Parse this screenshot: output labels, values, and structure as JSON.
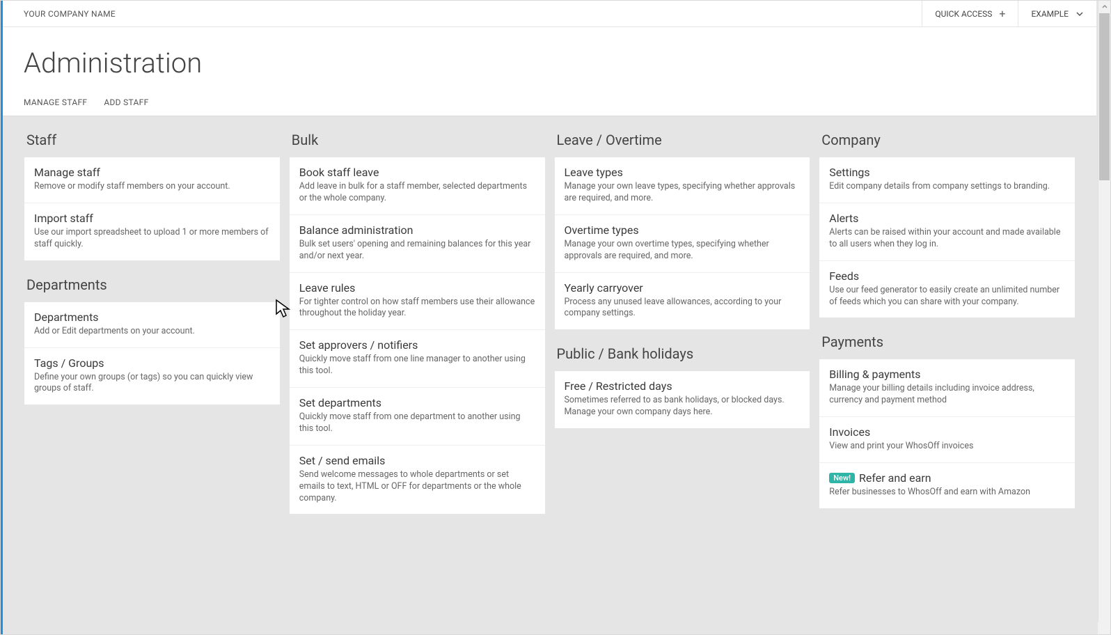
{
  "header": {
    "company": "YOUR COMPANY NAME",
    "quick_access": "QUICK ACCESS",
    "user_label": "EXAMPLE"
  },
  "page_title": "Administration",
  "tabs": {
    "manage_staff": "MANAGE STAFF",
    "add_staff": "ADD STAFF"
  },
  "sections": {
    "staff": {
      "title": "Staff"
    },
    "departments": {
      "title": "Departments"
    },
    "bulk": {
      "title": "Bulk"
    },
    "leave_overtime": {
      "title": "Leave / Overtime"
    },
    "public_bank": {
      "title": "Public / Bank holidays"
    },
    "company": {
      "title": "Company"
    },
    "payments": {
      "title": "Payments"
    }
  },
  "items": {
    "manage_staff": {
      "title": "Manage staff",
      "desc": "Remove or modify staff members on your account."
    },
    "import_staff": {
      "title": "Import staff",
      "desc": "Use our import spreadsheet to upload 1 or more members of staff quickly."
    },
    "departments": {
      "title": "Departments",
      "desc": "Add or Edit departments on your account."
    },
    "tags_groups": {
      "title": "Tags / Groups",
      "desc": "Define your own groups (or tags) so you can quickly view groups of staff."
    },
    "book_staff_leave": {
      "title": "Book staff leave",
      "desc": "Add leave in bulk for a staff member, selected departments or the whole company."
    },
    "balance_admin": {
      "title": "Balance administration",
      "desc": "Bulk set users' opening and remaining balances for this year and/or next year."
    },
    "leave_rules": {
      "title": "Leave rules",
      "desc": "For tighter control on how staff members use their allowance throughout the holiday year."
    },
    "set_approvers": {
      "title": "Set approvers / notifiers",
      "desc": "Quickly move staff from one line manager to another using this tool."
    },
    "set_departments": {
      "title": "Set departments",
      "desc": "Quickly move staff from one department to another using this tool."
    },
    "set_send_emails": {
      "title": "Set / send emails",
      "desc": "Send welcome messages to whole departments or set emails to text, HTML or OFF for departments or the whole company."
    },
    "leave_types": {
      "title": "Leave types",
      "desc": "Manage your own leave types, specifying whether approvals are required, and more."
    },
    "overtime_types": {
      "title": "Overtime types",
      "desc": "Manage your own overtime types, specifying whether approvals are required, and more."
    },
    "yearly_carryover": {
      "title": "Yearly carryover",
      "desc": "Process any unused leave allowances, according to your company settings."
    },
    "free_restricted": {
      "title": "Free / Restricted days",
      "desc": "Sometimes referred to as bank holidays, or blocked days. Manage your own company days here."
    },
    "settings": {
      "title": "Settings",
      "desc": "Edit company details from company settings to branding."
    },
    "alerts": {
      "title": "Alerts",
      "desc": "Alerts can be raised within your account and made available to all users when they log in."
    },
    "feeds": {
      "title": "Feeds",
      "desc": "Use our feed generator to easily create an unlimited number of feeds which you can share with your company."
    },
    "billing": {
      "title": "Billing & payments",
      "desc": "Manage your billing details including invoice address, currency and payment method"
    },
    "invoices": {
      "title": "Invoices",
      "desc": "View and print your WhosOff invoices"
    },
    "refer_earn": {
      "title": "Refer and earn",
      "desc": "Refer businesses to WhosOff and earn with Amazon",
      "badge": "New!"
    }
  }
}
